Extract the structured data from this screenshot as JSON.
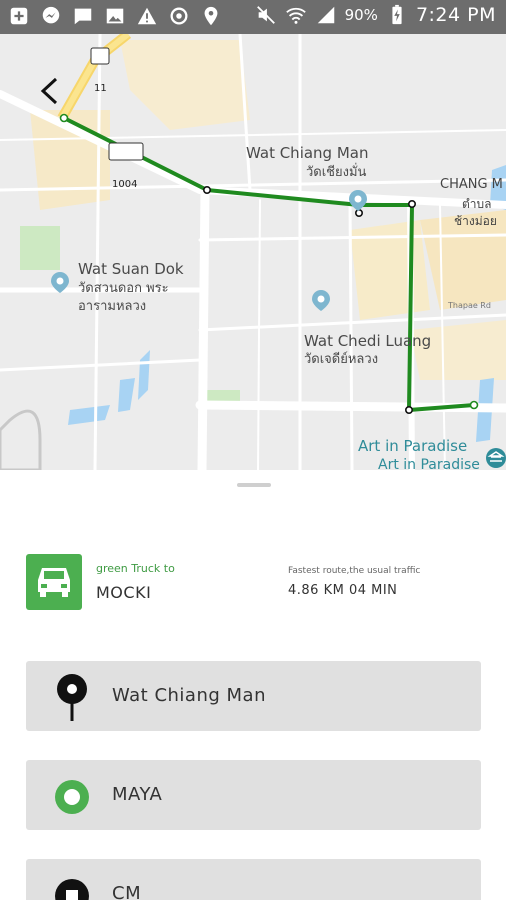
{
  "status_bar": {
    "battery_percent": "90%",
    "time": "7:24 PM",
    "left_icons": [
      "add-icon",
      "messenger-icon",
      "message-icon",
      "image-icon",
      "warning-icon",
      "sync-icon",
      "location-icon"
    ],
    "right_icons": [
      "mute-icon",
      "wifi-icon",
      "signal-icon",
      "battery-charging-icon"
    ]
  },
  "map": {
    "road_shields": [
      "11",
      "1004"
    ],
    "places": [
      {
        "name": "Wat Chiang Man",
        "name_th": "วัดเชียงมั่น"
      },
      {
        "name": "Wat Suan Dok",
        "name_th": "วัดสวนดอก พระ",
        "name_th_2": "อารามหลวง"
      },
      {
        "name": "Wat Chedi Luang",
        "name_th": "วัดเจดีย์หลวง"
      },
      {
        "name": "Art in Paradise",
        "name_2": "Art in Paradise"
      }
    ],
    "edge_labels": {
      "chang_m": "CHANG M",
      "th_1": "ตำบล",
      "th_2": "ช้างม่อย",
      "street": "Thapae Rd"
    },
    "route_color": "#1f8a1f"
  },
  "sheet": {
    "vehicle_title": "green Truck to",
    "destination": "MOCKI",
    "route_title": "Fastest route,the usual traffic",
    "route_info": "4.86 KM 04 MIN",
    "stops": [
      {
        "label": "Wat Chiang Man",
        "icon": "pin-icon"
      },
      {
        "label": "MAYA",
        "icon": "circle-icon"
      },
      {
        "label": "CM",
        "icon": "square-stop-icon"
      }
    ],
    "accent_color": "#4caf50"
  }
}
